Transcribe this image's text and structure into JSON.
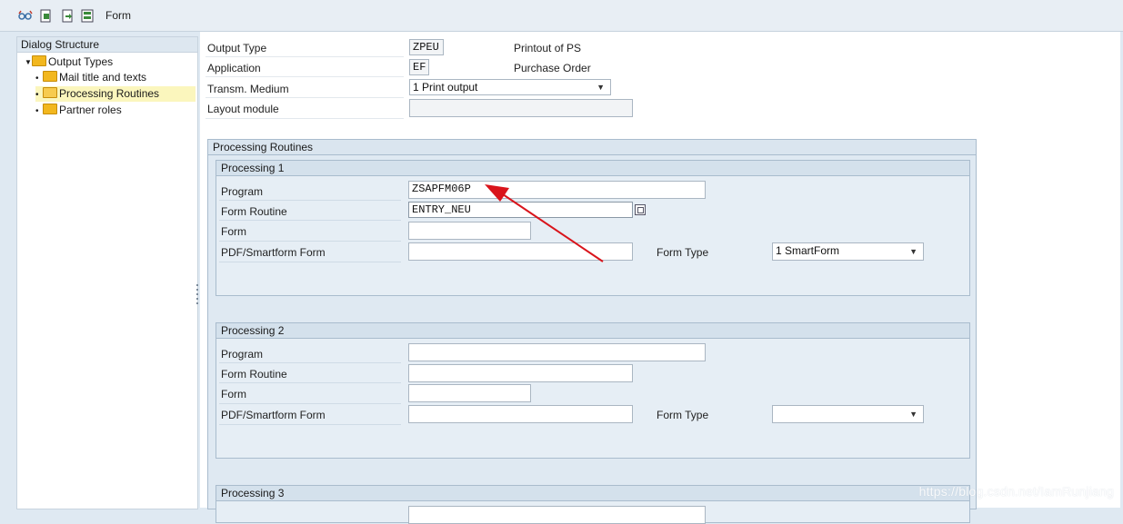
{
  "toolbar": {
    "title": "Form",
    "icons": [
      "glasses-display-icon",
      "new-entry-icon",
      "copy-entry-icon",
      "delete-entry-icon"
    ]
  },
  "dialog": {
    "header": "Dialog Structure",
    "items": [
      {
        "label": "Output Types",
        "level": 0
      },
      {
        "label": "Mail title and texts",
        "level": 1
      },
      {
        "label": "Processing Routines",
        "level": 1,
        "selected": true
      },
      {
        "label": "Partner roles",
        "level": 1
      }
    ]
  },
  "header_fields": {
    "output_type": {
      "label": "Output Type",
      "value": "ZPEU",
      "desc": "Printout of PS"
    },
    "application": {
      "label": "Application",
      "value": "EF",
      "desc": "Purchase Order"
    },
    "medium": {
      "label": "Transm. Medium",
      "value": "1 Print output"
    },
    "layout": {
      "label": "Layout module",
      "value": ""
    }
  },
  "group_title": "Processing Routines",
  "processing1": {
    "title": "Processing 1",
    "program_label": "Program",
    "program": "ZSAPFM06P",
    "routine_label": "Form Routine",
    "routine": "ENTRY_NEU",
    "form_label": "Form",
    "form": "",
    "pdf_label": "PDF/Smartform Form",
    "pdf": "",
    "formtype_label": "Form Type",
    "formtype": "1 SmartForm"
  },
  "processing2": {
    "title": "Processing 2",
    "program_label": "Program",
    "program": "",
    "routine_label": "Form Routine",
    "routine": "",
    "form_label": "Form",
    "form": "",
    "pdf_label": "PDF/Smartform Form",
    "pdf": "",
    "formtype_label": "Form Type",
    "formtype": ""
  },
  "processing3": {
    "title": "Processing 3"
  },
  "watermark": "https://blog.csdn.net/IamRunjiang",
  "colors": {
    "annotation_arrow": "#d9141b",
    "selected_row": "#fbf6bd",
    "folder": "#f2b71e"
  }
}
